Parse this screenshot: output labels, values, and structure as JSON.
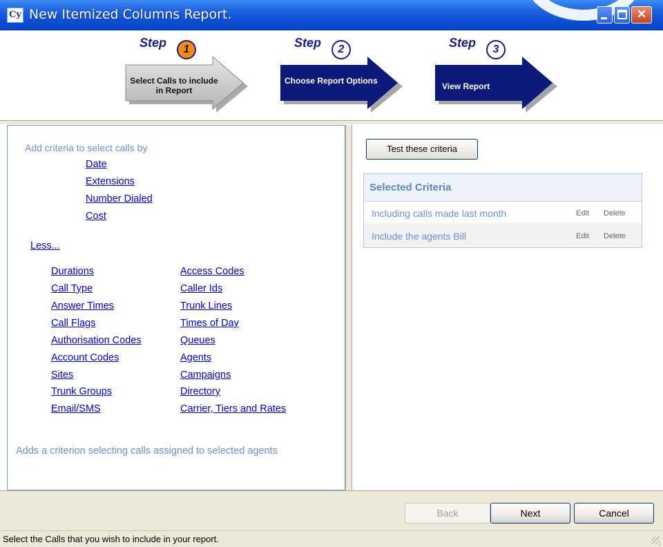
{
  "window": {
    "title": "New Itemized Columns Report.",
    "logo_text": "Cy"
  },
  "steps": [
    {
      "word": "Step",
      "number": "1",
      "label": "Select Calls to include in Report",
      "active": true
    },
    {
      "word": "Step",
      "number": "2",
      "label": "Choose Report Options",
      "active": false
    },
    {
      "word": "Step",
      "number": "3",
      "label": "View Report",
      "active": false
    }
  ],
  "left_panel": {
    "header_hint": "Add criteria to select calls by",
    "primary_links": [
      "Date",
      "Extensions",
      "Number Dialed",
      "Cost"
    ],
    "less_link": "Less...",
    "col1_links": [
      "Durations",
      "Call Type",
      "Answer Times",
      "Call Flags",
      "Authorisation Codes",
      "Account Codes",
      "Sites",
      "Trunk Groups",
      "Email/SMS"
    ],
    "col2_links": [
      "Access Codes",
      "Caller Ids",
      "Trunk Lines",
      "Times of Day",
      "Queues",
      "Agents",
      "Campaigns",
      "Directory",
      "Carrier, Tiers and Rates"
    ],
    "footer_hint": "Adds a criterion selecting calls assigned to selected agents"
  },
  "right_panel": {
    "test_button": "Test these criteria",
    "criteria_title": "Selected Criteria",
    "criteria": [
      {
        "text": "Including calls made last month",
        "edit": "Edit",
        "delete": "Delete"
      },
      {
        "text": "Include the agents Bill",
        "edit": "Edit",
        "delete": "Delete"
      }
    ]
  },
  "buttons": {
    "back": "Back",
    "next": "Next",
    "cancel": "Cancel"
  },
  "status": "Select the Calls that you wish to include in your report.",
  "colors": {
    "titlebar": "#0a4fd5",
    "step_active": "#c8c8c8",
    "step_inactive": "#0d1a7a",
    "step_number_active": "#f48c14",
    "link": "#0000cc",
    "hint": "#6b8fd8"
  }
}
